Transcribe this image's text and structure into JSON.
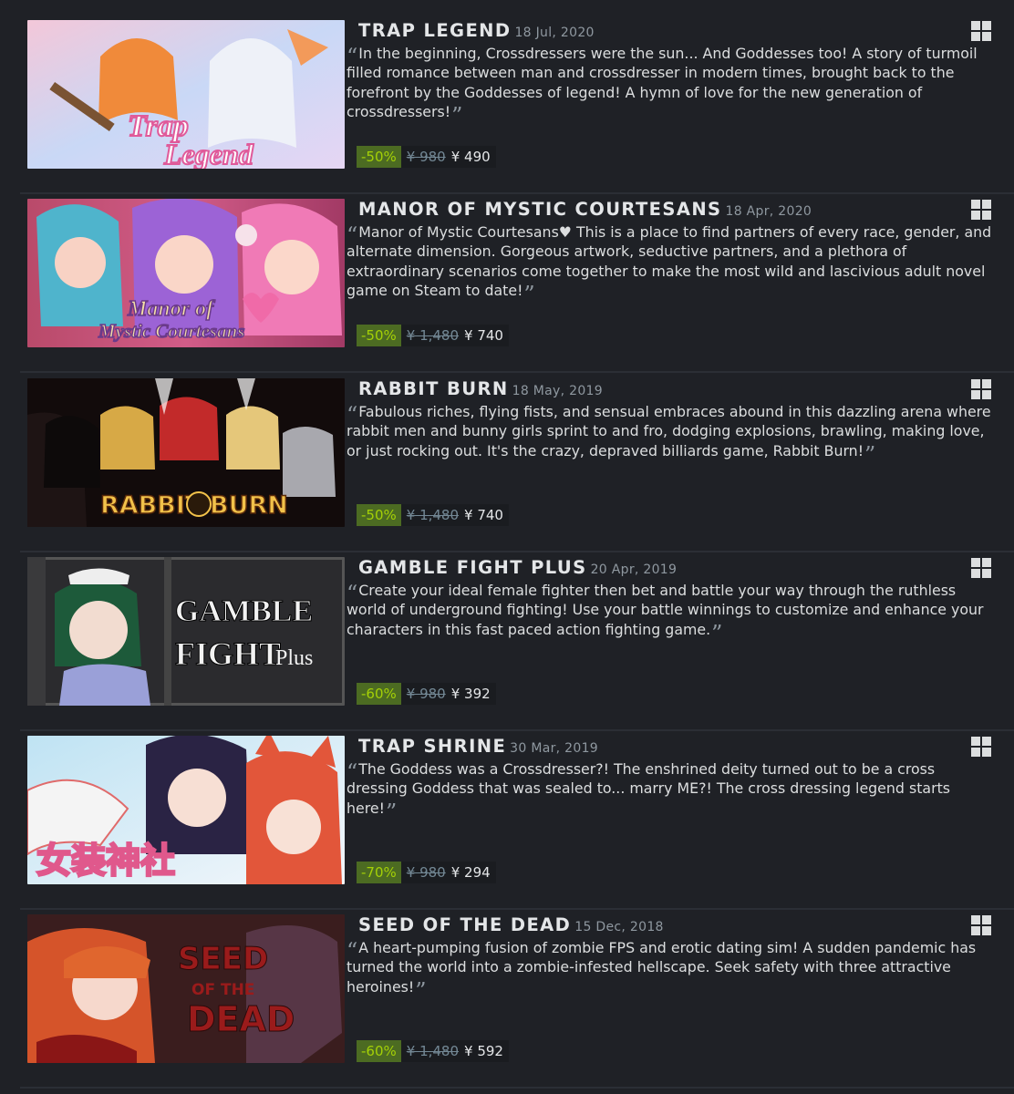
{
  "games": [
    {
      "title": "TRAP LEGEND",
      "date": "18 Jul, 2020",
      "description": "In the beginning, Crossdressers were the sun... And Goddesses too! A story of turmoil filled romance between man and crossdresser in modern times, brought back to the forefront by the Goddesses of legend! A hymn of love for the new generation of crossdressers!",
      "discount": "-50%",
      "original_price": "¥ 980",
      "final_price": "¥ 490",
      "capsule_logo": "Trap Legend",
      "platform": "windows-icon"
    },
    {
      "title": "MANOR OF MYSTIC COURTESANS",
      "date": "18 Apr, 2020",
      "description": "Manor of Mystic Courtesans♥ This is a place to find partners of every race, gender, and alternate dimension. Gorgeous artwork, seductive partners, and a plethora of extraordinary scenarios come together to make the most wild and lascivious adult novel game on Steam to date!",
      "discount": "-50%",
      "original_price": "¥ 1,480",
      "final_price": "¥ 740",
      "capsule_logo": "Manor of Mystic Courtesans",
      "platform": "windows-icon"
    },
    {
      "title": "RABBIT BURN",
      "date": "18 May, 2019",
      "description": "Fabulous riches, flying fists, and sensual embraces abound in this dazzling arena where rabbit men and bunny girls sprint to and fro, dodging explosions, brawling, making love, or just rocking out. It's the crazy, depraved billiards game, Rabbit Burn!",
      "discount": "-50%",
      "original_price": "¥ 1,480",
      "final_price": "¥ 740",
      "capsule_logo": "RABBIT BURN",
      "platform": "windows-icon"
    },
    {
      "title": "GAMBLE FIGHT PLUS",
      "date": "20 Apr, 2019",
      "description": "Create your ideal female fighter then bet and battle your way through the ruthless world of underground fighting! Use your battle winnings to customize and enhance your characters in this fast paced action fighting game.",
      "discount": "-60%",
      "original_price": "¥ 980",
      "final_price": "¥ 392",
      "capsule_logo": "GAMBLE FIGHT Plus",
      "platform": "windows-icon"
    },
    {
      "title": "TRAP SHRINE",
      "date": "30 Mar, 2019",
      "description": "The Goddess was a Crossdresser?! The enshrined deity turned out to be a cross dressing Goddess that was sealed to... marry ME?! The cross dressing legend starts here!",
      "discount": "-70%",
      "original_price": "¥ 980",
      "final_price": "¥ 294",
      "capsule_logo": "女装神社",
      "platform": "windows-icon"
    },
    {
      "title": "SEED OF THE DEAD",
      "date": "15 Dec, 2018",
      "description": "A heart-pumping fusion of zombie FPS and erotic dating sim! A sudden pandemic has turned the world into a zombie-infested hellscape. Seek safety with three attractive heroines!",
      "discount": "-60%",
      "original_price": "¥ 1,480",
      "final_price": "¥ 592",
      "capsule_logo": "SEED OF THE DEAD",
      "platform": "windows-icon"
    }
  ],
  "colors": {
    "background": "#1f2126",
    "discount_bg": "#4c6b22",
    "discount_text": "#a4d007",
    "price_text": "#e4e6e8",
    "original_price_text": "#738895",
    "date_text": "#8f98a0"
  }
}
